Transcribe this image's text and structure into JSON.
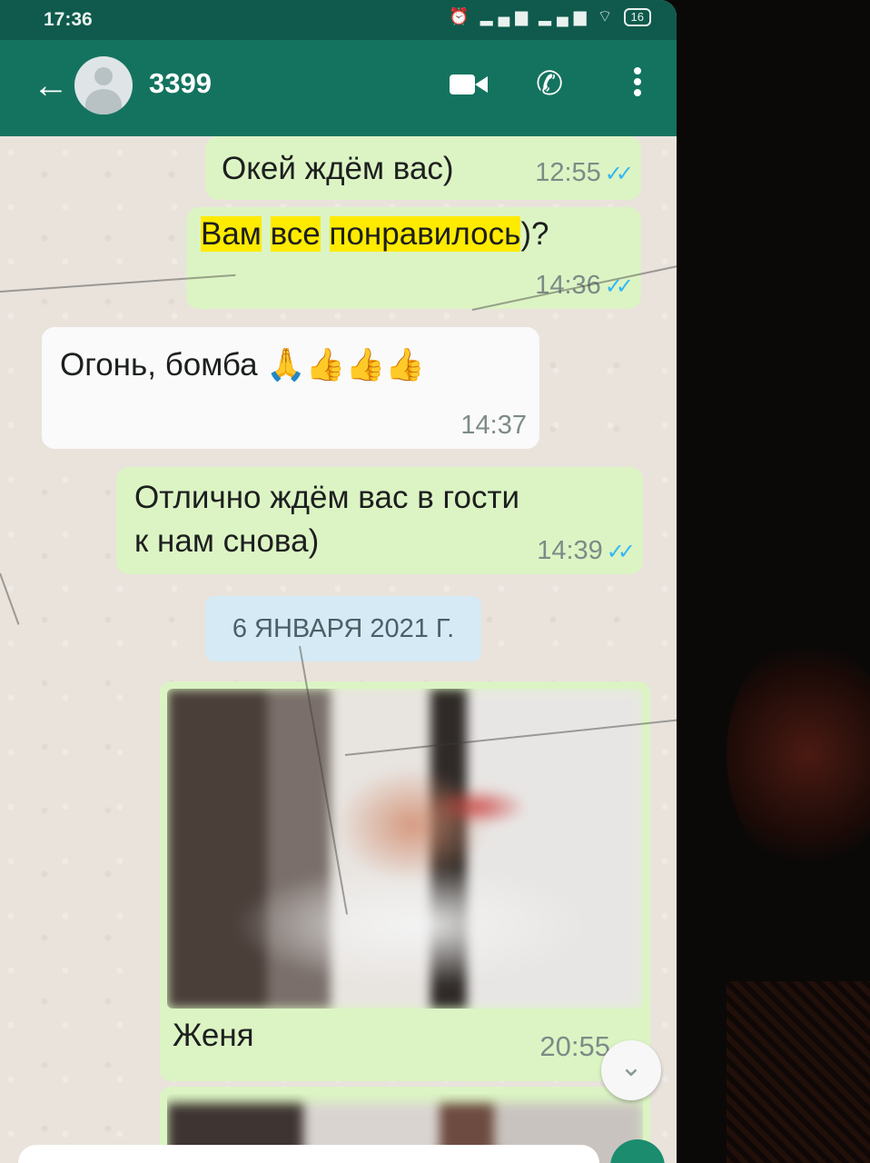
{
  "status_bar": {
    "time": "17:36",
    "battery": "16"
  },
  "header": {
    "contact_name": "3399"
  },
  "messages": [
    {
      "direction": "outgoing",
      "text": "Окей ждём вас)",
      "time": "12:55"
    },
    {
      "direction": "outgoing",
      "text_highlighted": [
        "Вам",
        "все",
        "понравилось"
      ],
      "text_tail": ")?",
      "time": "14:36"
    },
    {
      "direction": "incoming",
      "text": "Огонь, бомба 🙏👍👍👍",
      "time": "14:37"
    },
    {
      "direction": "outgoing",
      "text_line1": "Отлично ждём вас в гости",
      "text_line2": "к нам снова)",
      "time": "14:39"
    }
  ],
  "date_separator": "6 ЯНВАРЯ 2021 Г.",
  "image_message": {
    "caption": "Женя",
    "time": "20:55"
  },
  "colors": {
    "header": "#14735f",
    "outgoing_bubble": "#dcf4c4",
    "incoming_bubble": "#fafafa",
    "read_ticks": "#34b7f1",
    "highlight": "#ffeb00"
  }
}
